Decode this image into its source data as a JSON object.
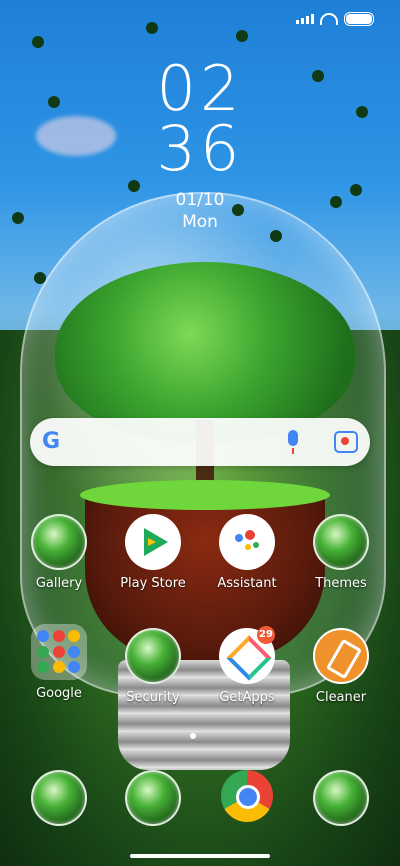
{
  "status_bar": {
    "signal": "signal-icon",
    "wifi": "wifi-icon",
    "battery": "battery-icon"
  },
  "clock": {
    "hours": "02",
    "minutes": "36",
    "date": "01/10",
    "weekday": "Mon"
  },
  "search_bar": {
    "logo": "G",
    "mic_icon": "mic-icon",
    "lens_icon": "lens-icon"
  },
  "apps_row1": [
    {
      "label": "Gallery"
    },
    {
      "label": "Play Store"
    },
    {
      "label": "Assistant"
    },
    {
      "label": "Themes"
    }
  ],
  "apps_row2": [
    {
      "label": "Google"
    },
    {
      "label": "Security"
    },
    {
      "label": "GetApps",
      "badge": "29"
    },
    {
      "label": "Cleaner"
    }
  ],
  "dock": [
    {
      "icon": "app-icon-1"
    },
    {
      "icon": "app-icon-2"
    },
    {
      "icon": "chrome-icon"
    },
    {
      "icon": "app-icon-4"
    }
  ],
  "colors": {
    "badge": "#f15a35",
    "cleaner": "#f0922b",
    "google_blue": "#4285f4"
  }
}
